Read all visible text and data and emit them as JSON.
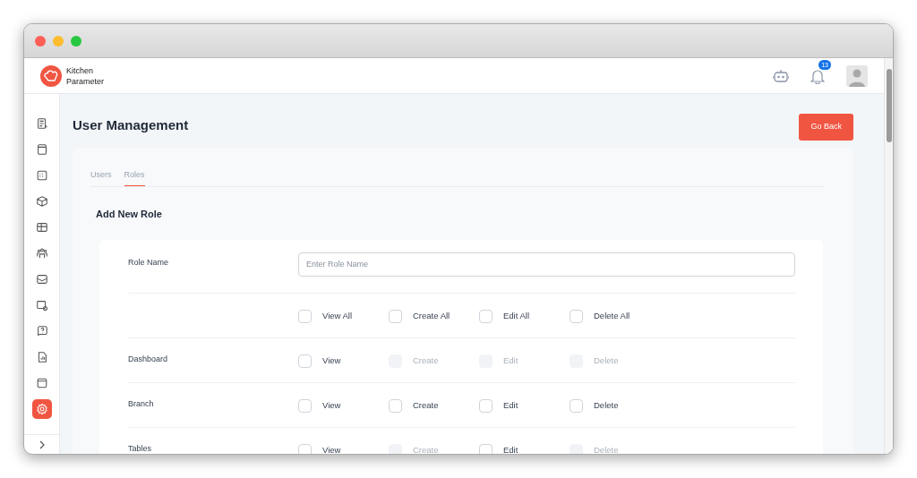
{
  "brand": {
    "line1": "Kitchen",
    "line2": "Parameter"
  },
  "header": {
    "notification_count": "13"
  },
  "sidebar": {
    "items": [
      {
        "selected": false
      },
      {
        "selected": false
      },
      {
        "selected": false
      },
      {
        "selected": false
      },
      {
        "selected": false
      },
      {
        "selected": false
      },
      {
        "selected": false
      },
      {
        "selected": false
      },
      {
        "selected": false
      },
      {
        "selected": false
      },
      {
        "selected": false
      },
      {
        "selected": true
      }
    ]
  },
  "page": {
    "title": "User Management",
    "back_button": "Go Back"
  },
  "tabs": [
    {
      "label": "Users",
      "selected": false
    },
    {
      "label": "Roles",
      "selected": true
    }
  ],
  "form": {
    "heading": "Add New Role",
    "role_name": {
      "label": "Role Name",
      "placeholder": "Enter Role Name"
    },
    "rows": [
      {
        "perms": [
          {
            "label": "View All",
            "checked": false,
            "disabled": false
          },
          {
            "label": "Create All",
            "checked": false,
            "disabled": false
          },
          {
            "label": "Edit All",
            "checked": false,
            "disabled": false
          },
          {
            "label": "Delete All",
            "checked": false,
            "disabled": false
          }
        ]
      },
      {
        "label": "Dashboard",
        "perms": [
          {
            "label": "View",
            "checked": false,
            "disabled": false
          },
          {
            "label": "Create",
            "checked": false,
            "disabled": true
          },
          {
            "label": "Edit",
            "checked": false,
            "disabled": true
          },
          {
            "label": "Delete",
            "checked": false,
            "disabled": true
          }
        ]
      },
      {
        "label": "Branch",
        "perms": [
          {
            "label": "View",
            "checked": false,
            "disabled": false
          },
          {
            "label": "Create",
            "checked": false,
            "disabled": false
          },
          {
            "label": "Edit",
            "checked": false,
            "disabled": false
          },
          {
            "label": "Delete",
            "checked": false,
            "disabled": false
          }
        ]
      },
      {
        "label": "Tables",
        "perms": [
          {
            "label": "View",
            "checked": false,
            "disabled": false
          },
          {
            "label": "Create",
            "checked": false,
            "disabled": true
          },
          {
            "label": "Edit",
            "checked": false,
            "disabled": false
          },
          {
            "label": "Delete",
            "checked": false,
            "disabled": true
          }
        ]
      }
    ]
  }
}
